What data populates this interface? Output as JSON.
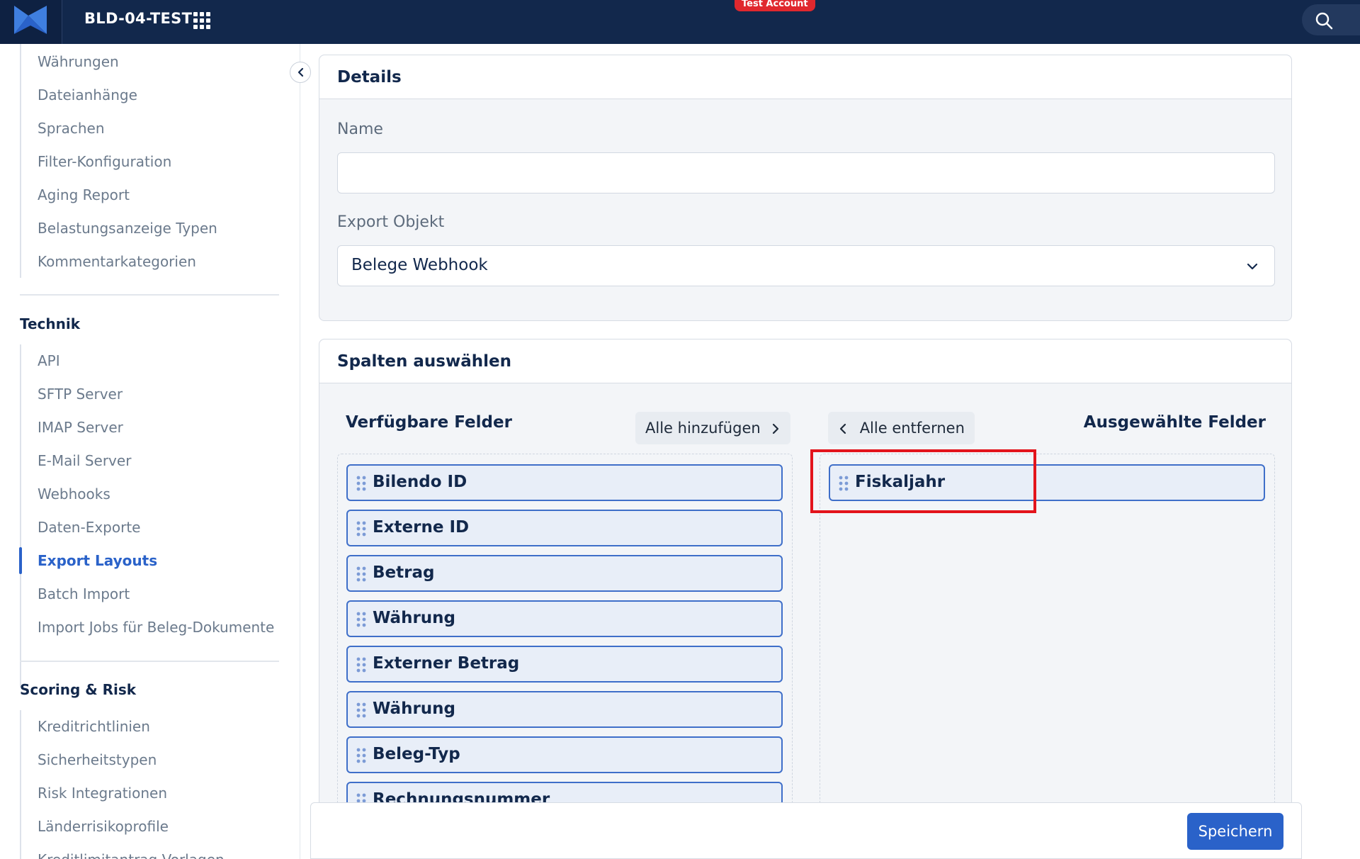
{
  "topbar": {
    "tenant_name": "BLD-04-TEST",
    "account_badge": "Test Account",
    "logo_icon": "bilendo-logo-icon",
    "apps_icon": "grid-apps-icon",
    "search_icon": "search-icon"
  },
  "sidebar": {
    "top_items": [
      {
        "label": "Währungen"
      },
      {
        "label": "Dateianhänge"
      },
      {
        "label": "Sprachen"
      },
      {
        "label": "Filter-Konfiguration"
      },
      {
        "label": "Aging Report"
      },
      {
        "label": "Belastungsanzeige Typen"
      },
      {
        "label": "Kommentarkategorien"
      }
    ],
    "technik": {
      "heading": "Technik",
      "items": [
        {
          "label": "API"
        },
        {
          "label": "SFTP Server"
        },
        {
          "label": "IMAP Server"
        },
        {
          "label": "E-Mail Server"
        },
        {
          "label": "Webhooks"
        },
        {
          "label": "Daten-Exporte"
        },
        {
          "label": "Export Layouts",
          "active": true
        },
        {
          "label": "Batch Import"
        },
        {
          "label": "Import Jobs für Beleg-Dokumente"
        }
      ]
    },
    "scoring": {
      "heading": "Scoring & Risk",
      "items": [
        {
          "label": "Kreditrichtlinien"
        },
        {
          "label": "Sicherheitstypen"
        },
        {
          "label": "Risk Integrationen"
        },
        {
          "label": "Länderrisikoprofile"
        },
        {
          "label": "Kreditlimitantrag Vorlagen"
        }
      ]
    }
  },
  "details": {
    "title": "Details",
    "name_label": "Name",
    "name_value": "",
    "export_object_label": "Export Objekt",
    "export_object_value": "Belege Webhook"
  },
  "columns": {
    "title": "Spalten auswählen",
    "available_title": "Verfügbare Felder",
    "selected_title": "Ausgewählte Felder",
    "add_all": "Alle hinzufügen",
    "remove_all": "Alle entfernen",
    "available_fields": [
      "Bilendo ID",
      "Externe ID",
      "Betrag",
      "Währung",
      "Externer Betrag",
      "Währung",
      "Beleg-Typ",
      "Rechnungsnummer"
    ],
    "selected_fields": [
      "Fiskaljahr"
    ]
  },
  "footer": {
    "save_label": "Speichern"
  },
  "colors": {
    "topbar": "#12284c",
    "accent": "#2a62c9",
    "badge": "#e0282e",
    "highlight": "#e3141c"
  }
}
